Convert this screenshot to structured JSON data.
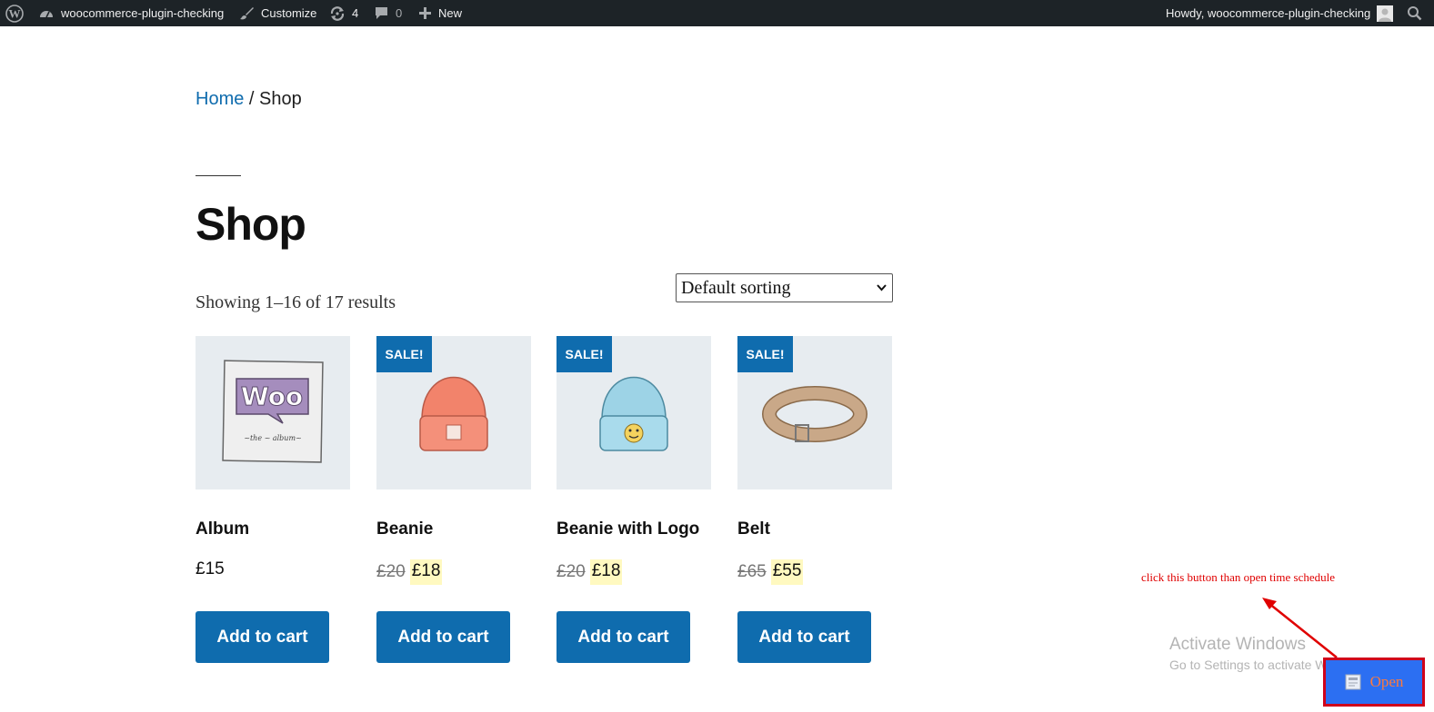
{
  "adminbar": {
    "wp_logo_icon": "wordpress-icon",
    "site_name": "woocommerce-plugin-checking",
    "customize_label": "Customize",
    "updates_count": "4",
    "comments_count": "0",
    "new_label": "New",
    "howdy_text": "Howdy, woocommerce-plugin-checking",
    "background_color": "#1d2327"
  },
  "breadcrumb": {
    "home": "Home",
    "separator": "/",
    "current": "Shop"
  },
  "page": {
    "title": "Shop",
    "result_count": "Showing 1–16 of 17 results",
    "sorting_selected": "Default sorting"
  },
  "products": [
    {
      "name": "Album",
      "sale": false,
      "badge": "",
      "regular_price": "",
      "price": "£15",
      "button": "Add to cart",
      "image_icon": "album-image"
    },
    {
      "name": "Beanie",
      "sale": true,
      "badge": "SALE!",
      "regular_price": "£20",
      "price": "£18",
      "button": "Add to cart",
      "image_icon": "beanie-image"
    },
    {
      "name": "Beanie with Logo",
      "sale": true,
      "badge": "SALE!",
      "regular_price": "£20",
      "price": "£18",
      "button": "Add to cart",
      "image_icon": "beanie-with-logo-image"
    },
    {
      "name": "Belt",
      "sale": true,
      "badge": "SALE!",
      "regular_price": "£65",
      "price": "£55",
      "button": "Add to cart",
      "image_icon": "belt-image"
    }
  ],
  "annotation": {
    "text": "click this button than open time schedule",
    "color": "#e00000"
  },
  "watermark": {
    "title": "Activate Windows",
    "subtitle": "Go to Settings to activate Windows."
  },
  "open_button": {
    "label": "Open",
    "background": "#2c6ff2",
    "border": "#d0021b"
  },
  "colors": {
    "accent": "#0f6cae",
    "sale_highlight": "#fff9c0"
  }
}
